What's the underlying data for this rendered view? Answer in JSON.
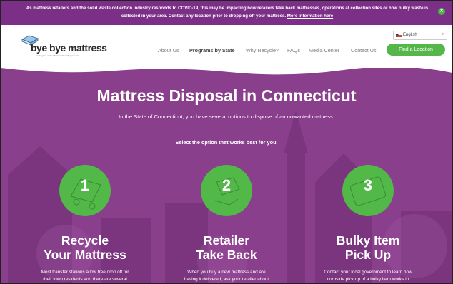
{
  "banner": {
    "text": "As mattress retailers and the solid waste collection industry responds to COVID-19, this may be impacting how retailers take back mattresses, operations at collection sites or how bulky waste is collected in your area. Contact any location prior to dropping off your mattress.",
    "link_label": "More information here"
  },
  "brand": {
    "name": "bye bye mattress",
    "tagline": "A Program of the Mattress Recycling Council"
  },
  "nav": {
    "items": [
      {
        "label": "About Us"
      },
      {
        "label": "Programs by State"
      },
      {
        "label": "Why Recycle?"
      },
      {
        "label": "FAQs"
      },
      {
        "label": "Media Center"
      },
      {
        "label": "Contact Us"
      }
    ],
    "active": "Programs by State",
    "cta_label": "Find a Location"
  },
  "language": {
    "selected": "English"
  },
  "hero": {
    "title": "Mattress Disposal in Connecticut",
    "subtitle": "In the State of Connecticut, you have several options to dispose of an unwanted mattress.",
    "select_prompt": "Select the option that works best for you."
  },
  "options": [
    {
      "number": "1",
      "title_line1": "Recycle",
      "title_line2": "Your Mattress",
      "body_line1": "Most transfer stations allow free drop off for",
      "body_line2": "their town residents and there are several"
    },
    {
      "number": "2",
      "title_line1": "Retailer",
      "title_line2": "Take Back",
      "body_line1": "When you buy a new mattress and are",
      "body_line2": "having it delivered, ask your retailer about"
    },
    {
      "number": "3",
      "title_line1": "Bulky Item",
      "title_line2": "Pick Up",
      "body_line1": "Contact your local government to learn how",
      "body_line2": "curbside pick up of a bulky item works in"
    }
  ],
  "colors": {
    "banner_purple": "#7b2f86",
    "hero_purple": "#8a3f8c",
    "accent_green": "#55b74a"
  }
}
